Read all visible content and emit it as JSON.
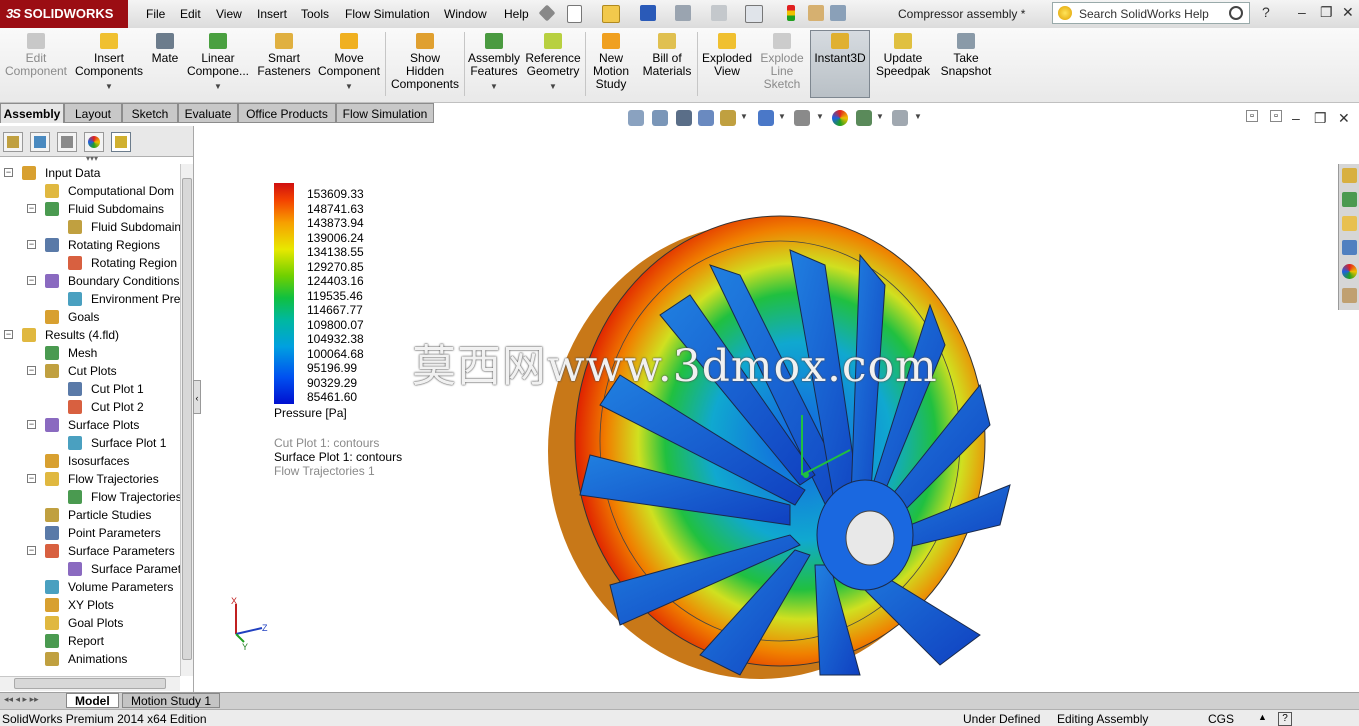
{
  "app": {
    "logo_text": "SOLIDWORKS",
    "document_title": "Compressor assembly *",
    "search_placeholder": "Search SolidWorks Help"
  },
  "menu": [
    "File",
    "Edit",
    "View",
    "Insert",
    "Tools",
    "Flow Simulation",
    "Window",
    "Help"
  ],
  "ribbon": [
    {
      "label": "Edit\nComponent",
      "icon": "edit-component-icon",
      "enabled": false
    },
    {
      "label": "Insert\nComponents",
      "icon": "insert-components-icon",
      "enabled": true
    },
    {
      "label": "Mate",
      "icon": "mate-icon",
      "enabled": true
    },
    {
      "label": "Linear\nCompone...",
      "icon": "linear-pattern-icon",
      "enabled": true
    },
    {
      "label": "Smart\nFasteners",
      "icon": "smart-fasteners-icon",
      "enabled": true
    },
    {
      "label": "Move\nComponent",
      "icon": "move-component-icon",
      "enabled": true
    },
    {
      "label": "Show\nHidden\nComponents",
      "icon": "show-hidden-icon",
      "enabled": true
    },
    {
      "label": "Assembly\nFeatures",
      "icon": "assembly-features-icon",
      "enabled": true
    },
    {
      "label": "Reference\nGeometry",
      "icon": "reference-geometry-icon",
      "enabled": true
    },
    {
      "label": "New\nMotion\nStudy",
      "icon": "motion-study-icon",
      "enabled": true
    },
    {
      "label": "Bill of\nMaterials",
      "icon": "bom-icon",
      "enabled": true
    },
    {
      "label": "Exploded\nView",
      "icon": "exploded-view-icon",
      "enabled": true
    },
    {
      "label": "Explode\nLine\nSketch",
      "icon": "explode-line-icon",
      "enabled": false
    },
    {
      "label": "Instant3D",
      "icon": "instant3d-icon",
      "enabled": true,
      "active": true
    },
    {
      "label": "Update\nSpeedpak",
      "icon": "speedpak-icon",
      "enabled": true
    },
    {
      "label": "Take\nSnapshot",
      "icon": "snapshot-icon",
      "enabled": true
    }
  ],
  "tabs": [
    "Assembly",
    "Layout",
    "Sketch",
    "Evaluate",
    "Office Products",
    "Flow Simulation"
  ],
  "active_tab": "Assembly",
  "tree": [
    {
      "label": "Input Data",
      "level": 0,
      "toggle": "minus",
      "icon": "input-data-icon"
    },
    {
      "label": "Computational Dom",
      "level": 1,
      "toggle": "",
      "icon": "computational-domain-icon"
    },
    {
      "label": "Fluid Subdomains",
      "level": 1,
      "toggle": "minus",
      "icon": "fluid-subdomain-icon"
    },
    {
      "label": "Fluid Subdomain",
      "level": 2,
      "toggle": "",
      "icon": "fluid-subdomain-icon"
    },
    {
      "label": "Rotating Regions",
      "level": 1,
      "toggle": "minus",
      "icon": "rotating-region-icon"
    },
    {
      "label": "Rotating Region",
      "level": 2,
      "toggle": "",
      "icon": "rotating-region-icon"
    },
    {
      "label": "Boundary Conditions",
      "level": 1,
      "toggle": "minus",
      "icon": "boundary-condition-icon"
    },
    {
      "label": "Environment Pre",
      "level": 2,
      "toggle": "",
      "icon": "environment-pressure-icon"
    },
    {
      "label": "Goals",
      "level": 1,
      "toggle": "",
      "icon": "goals-icon"
    },
    {
      "label": "Results (4.fld)",
      "level": 0,
      "toggle": "minus",
      "icon": "results-icon"
    },
    {
      "label": "Mesh",
      "level": 1,
      "toggle": "",
      "icon": "mesh-icon"
    },
    {
      "label": "Cut Plots",
      "level": 1,
      "toggle": "minus",
      "icon": "cut-plots-icon"
    },
    {
      "label": "Cut Plot 1",
      "level": 2,
      "toggle": "",
      "icon": "cut-plot-icon"
    },
    {
      "label": "Cut Plot 2",
      "level": 2,
      "toggle": "",
      "icon": "cut-plot-icon"
    },
    {
      "label": "Surface Plots",
      "level": 1,
      "toggle": "minus",
      "icon": "surface-plots-icon"
    },
    {
      "label": "Surface Plot 1",
      "level": 2,
      "toggle": "",
      "icon": "surface-plot-icon"
    },
    {
      "label": "Isosurfaces",
      "level": 1,
      "toggle": "",
      "icon": "isosurfaces-icon"
    },
    {
      "label": "Flow Trajectories",
      "level": 1,
      "toggle": "minus",
      "icon": "flow-trajectories-icon"
    },
    {
      "label": "Flow Trajectories",
      "level": 2,
      "toggle": "",
      "icon": "flow-trajectory-icon"
    },
    {
      "label": "Particle Studies",
      "level": 1,
      "toggle": "",
      "icon": "particle-studies-icon"
    },
    {
      "label": "Point Parameters",
      "level": 1,
      "toggle": "",
      "icon": "point-parameters-icon"
    },
    {
      "label": "Surface Parameters",
      "level": 1,
      "toggle": "minus",
      "icon": "surface-parameters-icon"
    },
    {
      "label": "Surface Paramet",
      "level": 2,
      "toggle": "",
      "icon": "surface-parameter-icon"
    },
    {
      "label": "Volume Parameters",
      "level": 1,
      "toggle": "",
      "icon": "volume-parameters-icon"
    },
    {
      "label": "XY Plots",
      "level": 1,
      "toggle": "",
      "icon": "xy-plots-icon"
    },
    {
      "label": "Goal Plots",
      "level": 1,
      "toggle": "",
      "icon": "goal-plots-icon"
    },
    {
      "label": "Report",
      "level": 1,
      "toggle": "",
      "icon": "report-icon"
    },
    {
      "label": "Animations",
      "level": 1,
      "toggle": "",
      "icon": "animations-icon"
    }
  ],
  "legend": {
    "values": [
      "153609.33",
      "148741.63",
      "143873.94",
      "139006.24",
      "134138.55",
      "129270.85",
      "124403.16",
      "119535.46",
      "114667.77",
      "109800.07",
      "104932.38",
      "100064.68",
      "95196.99",
      "90329.29",
      "85461.60"
    ],
    "unit": "Pressure [Pa]"
  },
  "plot_list": [
    {
      "label": "Cut Plot 1: contours",
      "active": false
    },
    {
      "label": "Surface Plot 1: contours",
      "active": true
    },
    {
      "label": "Flow Trajectories 1",
      "active": false
    }
  ],
  "watermark": "莫西网www.3dmox.com",
  "bottom_tabs": [
    "Model",
    "Motion Study 1"
  ],
  "status": {
    "edition": "SolidWorks Premium 2014 x64 Edition",
    "state": "Under Defined",
    "mode": "Editing Assembly",
    "units": "CGS"
  }
}
